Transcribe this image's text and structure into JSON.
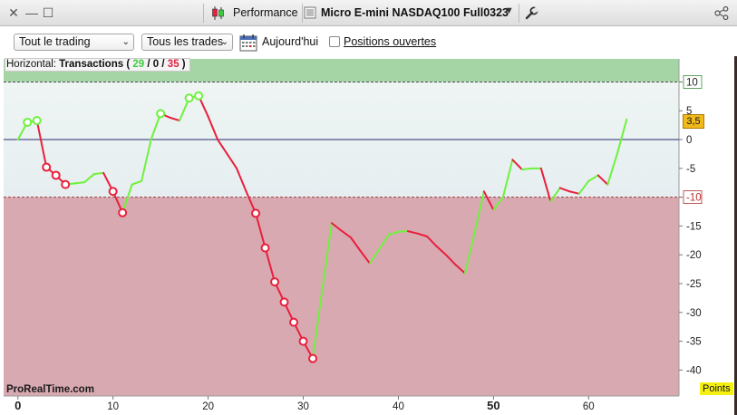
{
  "window": {
    "performance_label": "Performance",
    "instrument_label": "Micro E-mini NASDAQ100 Full0323"
  },
  "toolbar": {
    "period_select": "Tout le trading",
    "trades_select": "Tous les trades",
    "today_label": "Aujourd'hui",
    "open_positions_label": "Positions ouvertes",
    "open_positions_checked": false
  },
  "panel": {
    "prefix": "Horizontal:",
    "title": "Transactions",
    "open_paren": "(",
    "winners": "29",
    "sep1": "/",
    "neutral": "0",
    "sep2": "/",
    "losers": "35",
    "close_paren": ")",
    "watermark": "ProRealTime.com",
    "units": "Points",
    "last_value_label": "3,5"
  },
  "colors": {
    "win_line": "#6ef23c",
    "loss_line": "#e8203c",
    "win_zone": "#a5d5a5",
    "loss_zone": "#d9a9b2",
    "zero_line": "#2b2b6e"
  },
  "chart_data": {
    "type": "line",
    "xlim": [
      -1.5,
      69.5
    ],
    "ylim": [
      -44.5,
      14
    ],
    "x_ticks": [
      0,
      10,
      20,
      30,
      40,
      50,
      60
    ],
    "x_tick_labels": [
      "0",
      "10",
      "20",
      "30",
      "40",
      "50",
      "60"
    ],
    "y_ticks": [
      10,
      5,
      0,
      -5,
      -10,
      -15,
      -20,
      -25,
      -30,
      -35,
      -40
    ],
    "y_tick_labels": [
      "10",
      "5",
      "0",
      "-5",
      "-10",
      "-15",
      "-20",
      "-25",
      "-30",
      "-35",
      "-40"
    ],
    "upper_threshold": 10,
    "lower_threshold": -10,
    "last_value": 3.5,
    "x": [
      0,
      1,
      2,
      3,
      4,
      5,
      6,
      7,
      8,
      9,
      10,
      11,
      12,
      13,
      14,
      15,
      16,
      17,
      18,
      19,
      20,
      21,
      22,
      23,
      24,
      25,
      26,
      27,
      28,
      29,
      30,
      31,
      32,
      33,
      34,
      35,
      36,
      37,
      38,
      39,
      40,
      41,
      42,
      43,
      44,
      45,
      46,
      47,
      48,
      49,
      50,
      51,
      52,
      53,
      54,
      55,
      56,
      57,
      58,
      59,
      60,
      61,
      62,
      63,
      64
    ],
    "y": [
      0,
      3,
      3.3,
      -4.8,
      -6.2,
      -7.8,
      -7.6,
      -7.4,
      -6,
      -5.8,
      -9,
      -12.7,
      -7.8,
      -7.2,
      0,
      4.5,
      3.8,
      3.3,
      7.2,
      7.6,
      4,
      0,
      -2.5,
      -5,
      -9,
      -12.8,
      -18.8,
      -24.7,
      -28.2,
      -31.7,
      -35,
      -38,
      -26,
      -14.5,
      -15.8,
      -17,
      -19.3,
      -21.5,
      -19,
      -16.5,
      -16,
      -15.9,
      -16.3,
      -16.8,
      -18.5,
      -20,
      -21.7,
      -23.2,
      -16.3,
      -9,
      -12.2,
      -10,
      -3.5,
      -5.2,
      -5,
      -5,
      -10.7,
      -8.4,
      -9,
      -9.4,
      -7.2,
      -6.2,
      -7.8,
      -2.5,
      3.5
    ],
    "marked_points": [
      1,
      2,
      3,
      4,
      5,
      10,
      11,
      15,
      18,
      19,
      25,
      26,
      27,
      28,
      29,
      30,
      31
    ]
  }
}
